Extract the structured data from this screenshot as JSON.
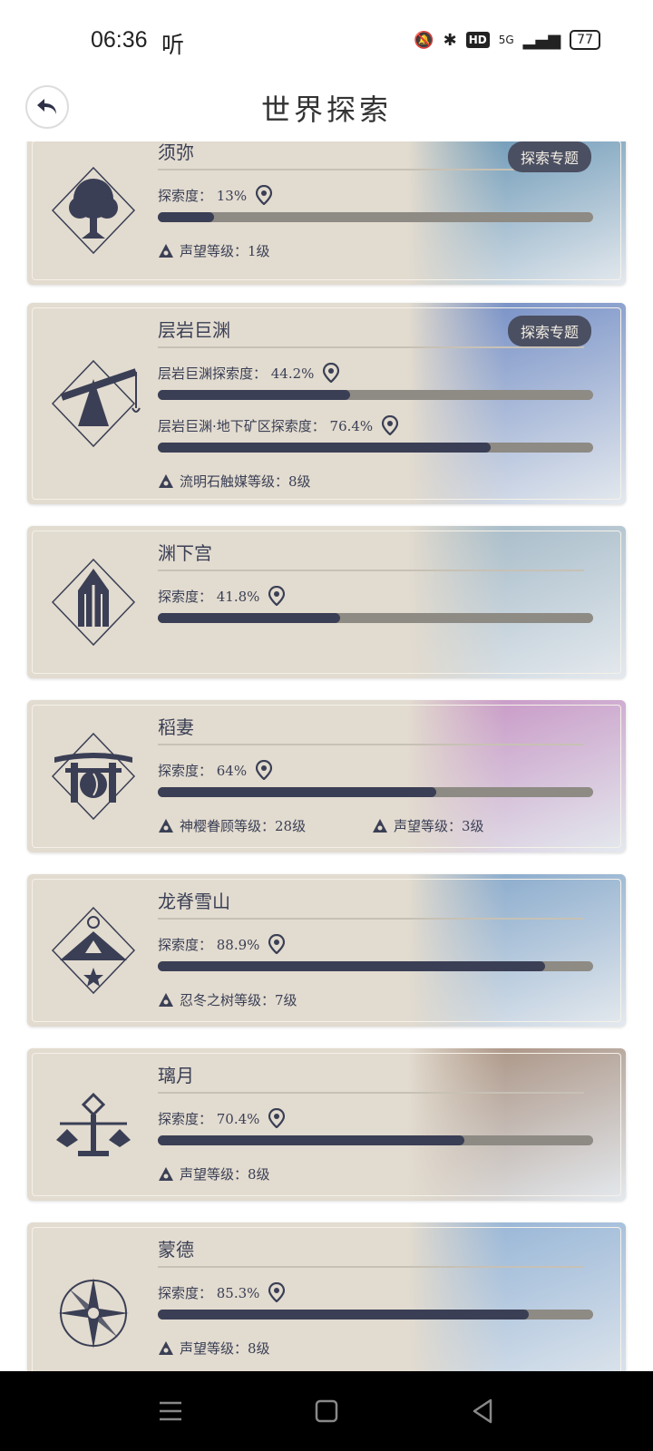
{
  "status_bar": {
    "time": "06:36",
    "speaker_mark": "听",
    "hd": "HD",
    "network": "5G",
    "battery": "77"
  },
  "header": {
    "title": "世界探索"
  },
  "tag_label": "探索专题",
  "regions": [
    {
      "name": "须弥",
      "art_color": "#5e8fb0",
      "tag": true,
      "progress": [
        {
          "label": "探索度：",
          "value": "13%",
          "fill": 0.13
        }
      ],
      "reputation": [
        {
          "text": "声望等级：1级",
          "icon": "reputation-icon"
        }
      ]
    },
    {
      "name": "层岩巨渊",
      "art_color": "#6b87c2",
      "tag": true,
      "progress": [
        {
          "label": "层岩巨渊探索度：",
          "value": "44.2%",
          "fill": 0.442
        },
        {
          "label": "层岩巨渊·地下矿区探索度：",
          "value": "76.4%",
          "fill": 0.764
        }
      ],
      "reputation": [
        {
          "text": "流明石触媒等级：8级",
          "icon": "lumenstone-icon"
        }
      ]
    },
    {
      "name": "渊下宫",
      "art_color": "#9fb6c4",
      "tag": false,
      "progress": [
        {
          "label": "探索度：",
          "value": "41.8%",
          "fill": 0.418
        }
      ],
      "reputation": []
    },
    {
      "name": "稻妻",
      "art_color": "#c58fc2",
      "tag": false,
      "progress": [
        {
          "label": "探索度：",
          "value": "64%",
          "fill": 0.64
        }
      ],
      "reputation": [
        {
          "text": "神樱眷顾等级：28级",
          "icon": "sakura-icon"
        },
        {
          "text": "声望等级：3级",
          "icon": "reputation-icon"
        }
      ]
    },
    {
      "name": "龙脊雪山",
      "art_color": "#7ea3c8",
      "tag": false,
      "progress": [
        {
          "label": "探索度：",
          "value": "88.9%",
          "fill": 0.889
        }
      ],
      "reputation": [
        {
          "text": "忍冬之树等级：7级",
          "icon": "frostbearing-icon"
        }
      ]
    },
    {
      "name": "璃月",
      "art_color": "#a48a78",
      "tag": false,
      "progress": [
        {
          "label": "探索度：",
          "value": "70.4%",
          "fill": 0.704
        }
      ],
      "reputation": [
        {
          "text": "声望等级：8级",
          "icon": "reputation-icon"
        }
      ]
    },
    {
      "name": "蒙德",
      "art_color": "#8fb0d4",
      "tag": false,
      "progress": [
        {
          "label": "探索度：",
          "value": "85.3%",
          "fill": 0.853
        }
      ],
      "reputation": [
        {
          "text": "声望等级：8级",
          "icon": "reputation-icon"
        }
      ]
    }
  ]
}
